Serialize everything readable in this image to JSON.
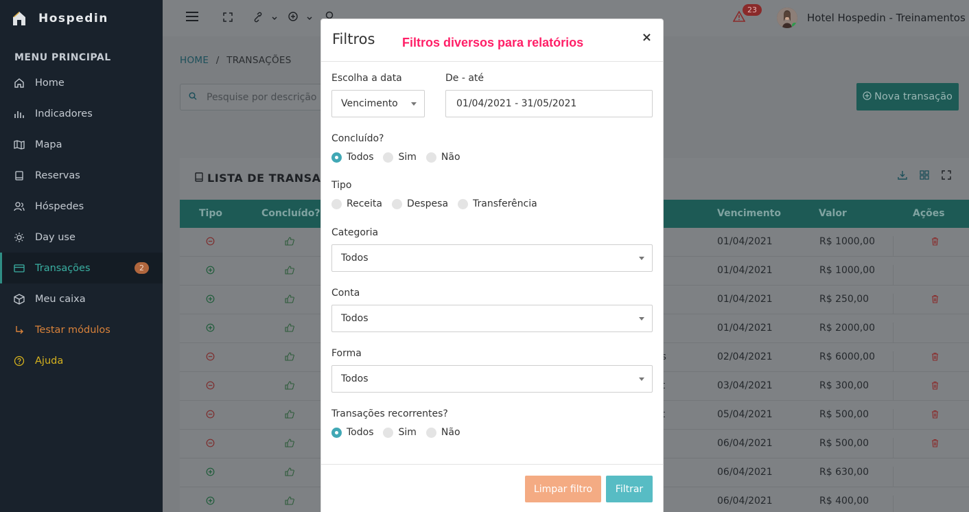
{
  "brand": {
    "name": "Hospedin"
  },
  "sidebar": {
    "title": "MENU PRINCIPAL",
    "items": [
      {
        "label": "Home",
        "icon": "home-icon"
      },
      {
        "label": "Indicadores",
        "icon": "bar-chart-icon"
      },
      {
        "label": "Mapa",
        "icon": "map-icon"
      },
      {
        "label": "Reservas",
        "icon": "book-icon"
      },
      {
        "label": "Hóspedes",
        "icon": "users-icon"
      },
      {
        "label": "Day use",
        "icon": "sun-icon"
      },
      {
        "label": "Transações",
        "icon": "card-icon",
        "badge": "2"
      },
      {
        "label": "Meu caixa",
        "icon": "box-icon"
      },
      {
        "label": "Testar módulos",
        "icon": "arrow-icon"
      },
      {
        "label": "Ajuda",
        "icon": "help-icon"
      }
    ]
  },
  "topbar": {
    "alerts": "23",
    "hotel": "Hotel Hospedin - Treinamentos"
  },
  "page": {
    "breadcrumb_home": "HOME",
    "breadcrumb_sep": "/",
    "breadcrumb_current": "TRANSAÇÕES",
    "search_placeholder": "Pesquise por descrição",
    "new_button": "Nova transação",
    "panel_title": "LISTA DE TRANSAÇ",
    "columns": {
      "tipo": "Tipo",
      "concluido": "Concluído?",
      "vencimento": "Vencimento",
      "valor": "Valor",
      "acoes": "Ações"
    },
    "rows": [
      {
        "tipo": "minus",
        "extra": "",
        "vencimento": "01/04/2021",
        "valor": "R$ 1000,00",
        "delete": true
      },
      {
        "tipo": "plus",
        "extra": "",
        "vencimento": "01/04/2021",
        "valor": "R$ 1000,00",
        "delete": false
      },
      {
        "tipo": "plus",
        "extra": "",
        "vencimento": "01/04/2021",
        "valor": "R$ 250,00",
        "delete": true
      },
      {
        "tipo": "plus",
        "extra": "",
        "vencimento": "01/04/2021",
        "valor": "R$ 2000,00",
        "delete": false
      },
      {
        "tipo": "minus",
        "extra": "os",
        "vencimento": "02/04/2021",
        "valor": "R$ 6000,00",
        "delete": true
      },
      {
        "tipo": "minus",
        "extra": "et",
        "vencimento": "03/04/2021",
        "valor": "R$ 300,00",
        "delete": true
      },
      {
        "tipo": "minus",
        "extra": "et",
        "vencimento": "05/04/2021",
        "valor": "R$ 500,00",
        "delete": true
      },
      {
        "tipo": "minus",
        "extra": "",
        "vencimento": "06/04/2021",
        "valor": "R$ 500,00",
        "delete": true
      },
      {
        "tipo": "plus",
        "extra": "",
        "vencimento": "06/04/2021",
        "valor": "R$ 630,00",
        "delete": false
      },
      {
        "tipo": "plus",
        "extra": "",
        "vencimento": "06/04/2021",
        "valor": "R$ 400,00",
        "delete": false
      }
    ]
  },
  "modal": {
    "title": "Filtros",
    "annotation": "Filtros diversos para relatórios",
    "close": "×",
    "date_label": "Escolha a data",
    "date_select": "Vencimento",
    "range_label": "De - até",
    "range_value": "01/04/2021 - 31/05/2021",
    "concluido_label": "Concluído?",
    "concluido_options": [
      "Todos",
      "Sim",
      "Não"
    ],
    "concluido_selected": "Todos",
    "tipo_label": "Tipo",
    "tipo_options": [
      "Receita",
      "Despesa",
      "Transferência"
    ],
    "categoria_label": "Categoria",
    "categoria_value": "Todos",
    "conta_label": "Conta",
    "conta_value": "Todos",
    "forma_label": "Forma",
    "forma_value": "Todos",
    "recorrentes_label": "Transações recorrentes?",
    "recorrentes_options": [
      "Todos",
      "Sim",
      "Não"
    ],
    "recorrentes_selected": "Todos",
    "clear_button": "Limpar filtro",
    "filter_button": "Filtrar"
  }
}
